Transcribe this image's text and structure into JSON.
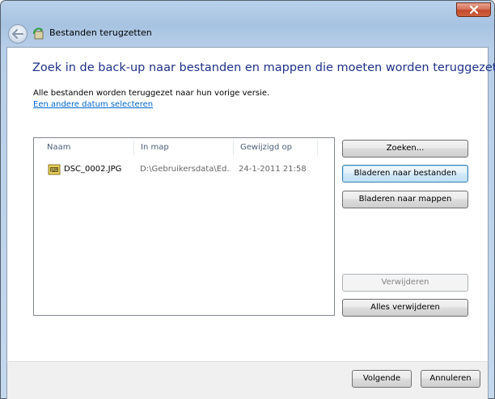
{
  "window": {
    "title": "Bestanden terugzetten"
  },
  "main": {
    "heading": "Zoek in de back-up naar bestanden en mappen die moeten worden teruggezet",
    "subtext": "Alle bestanden worden teruggezet naar hun vorige versie.",
    "date_link": "Een andere datum selecteren"
  },
  "file_list": {
    "columns": [
      "Naam",
      "In map",
      "Gewijzigd op"
    ],
    "rows": [
      {
        "name": "DSC_0002.JPG",
        "folder": "D:\\Gebruikersdata\\Ed...",
        "modified": "24-1-2011 21:58",
        "icon": "jpg-file-icon"
      }
    ]
  },
  "actions": {
    "search": "Zoeken...",
    "browse_files": "Bladeren naar bestanden",
    "browse_folders": "Bladeren naar mappen",
    "remove": "Verwijderen",
    "remove_all": "Alles verwijderen"
  },
  "footer": {
    "next": "Volgende",
    "cancel": "Annuleren"
  },
  "colors": {
    "heading": "#1e3287",
    "link": "#0066cc",
    "close_button": "#c24a2c"
  }
}
